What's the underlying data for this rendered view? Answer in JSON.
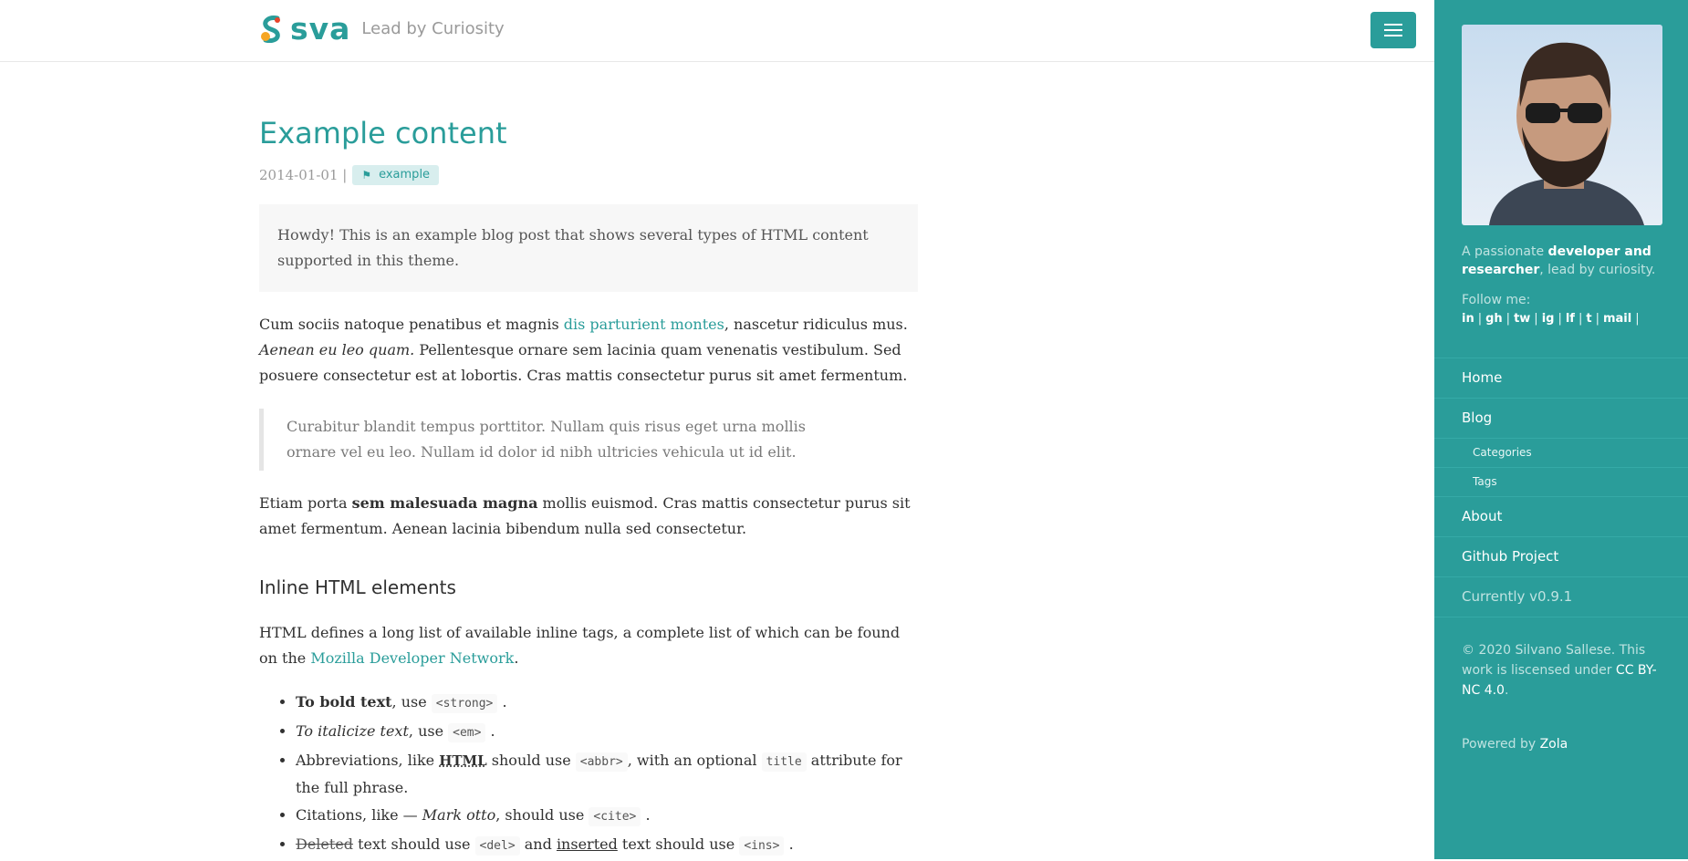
{
  "header": {
    "logo_text": "sva",
    "tagline": "Lead by Curiosity"
  },
  "post": {
    "title": "Example content",
    "date": "2014-01-01",
    "separator": "|",
    "tag": "example",
    "intro": "Howdy! This is an example blog post that shows several types of HTML content supported in this theme.",
    "p1_start": "Cum sociis natoque penatibus et magnis ",
    "p1_link": "dis parturient montes",
    "p1_mid": ", nascetur ridiculus mus. ",
    "p1_em": "Aenean eu leo quam.",
    "p1_end": " Pellentesque ornare sem lacinia quam venenatis vestibulum. Sed posuere consectetur est at lobortis. Cras mattis consectetur purus sit amet fermentum.",
    "quote": "Curabitur blandit tempus porttitor. Nullam quis risus eget urna mollis ornare vel eu leo. Nullam id dolor id nibh ultricies vehicula ut id elit.",
    "p2_start": "Etiam porta ",
    "p2_strong": "sem malesuada magna",
    "p2_end": " mollis euismod. Cras mattis consectetur purus sit amet fermentum. Aenean lacinia bibendum nulla sed consectetur.",
    "h2": "Inline HTML elements",
    "p3_start": "HTML defines a long list of available inline tags, a complete list of which can be found on the ",
    "p3_link": "Mozilla Developer Network",
    "p3_end": ".",
    "list": {
      "bold_strong": "To bold text",
      "bold_rest": ", use ",
      "bold_code": "<strong>",
      "italic_em": "To italicize text",
      "italic_rest": ", use ",
      "italic_code": "<em>",
      "abbr_start": "Abbreviations, like ",
      "abbr_word": "HTML",
      "abbr_mid": " should use ",
      "abbr_code": "<abbr>",
      "abbr_mid2": ", with an optional ",
      "abbr_code2": "title",
      "abbr_end": " attribute for the full phrase.",
      "cite_start": "Citations, like — ",
      "cite_em": "Mark otto",
      "cite_mid": ", should use ",
      "cite_code": "<cite>",
      "del_word": "Deleted",
      "del_mid": " text should use ",
      "del_code": "<del>",
      "del_and": " and ",
      "ins_word": "inserted",
      "ins_mid": " text should use ",
      "ins_code": "<ins>",
      "period": "."
    }
  },
  "sidebar": {
    "bio_start": "A passionate ",
    "bio_strong": "developer and researcher",
    "bio_end": ", lead by curiosity.",
    "follow": "Follow me:",
    "social": [
      "in",
      "gh",
      "tw",
      "ig",
      "lf",
      "t",
      "mail"
    ],
    "social_sep": "|",
    "nav": {
      "home": "Home",
      "blog": "Blog",
      "categories": "Categories",
      "tags": "Tags",
      "about": "About",
      "github": "Github Project",
      "version": "Currently v0.9.1"
    },
    "copyright_start": "© 2020 Silvano Sallese. This work is liscensed under ",
    "license": "CC BY-NC 4.0",
    "copyright_end": ".",
    "powered_start": "Powered by ",
    "powered_link": "Zola"
  },
  "colors": {
    "accent": "#2a9d9a",
    "text": "#313131",
    "muted": "#9a9a9a"
  }
}
